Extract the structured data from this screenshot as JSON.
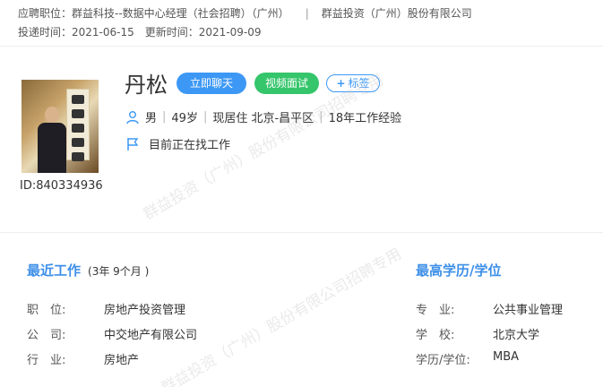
{
  "header": {
    "position_label": "应聘职位：",
    "position_value": "群益科技--数据中心经理（社会招聘）（广州）",
    "separator": "|",
    "company": "群益投资（广州）股份有限公司",
    "delivery_label": "投递时间：",
    "delivery_value": "2021-06-15",
    "update_label": "更新时间：",
    "update_value": "2021-09-09"
  },
  "profile": {
    "id_text": "ID:840334936",
    "name": "丹松",
    "buttons": {
      "chat": "立即聊天",
      "video": "视频面试",
      "tag": "标签"
    },
    "gender": "男",
    "age": "49岁",
    "residence": "现居住 北京-昌平区",
    "experience": "18年工作经验",
    "status": "目前正在找工作"
  },
  "recent_work": {
    "title": "最近工作",
    "duration": "(3年 9个月 )",
    "rows": [
      {
        "label": "职　位:",
        "value": "房地产投资管理"
      },
      {
        "label": "公　司:",
        "value": "中交地产有限公司"
      },
      {
        "label": "行　业:",
        "value": "房地产"
      }
    ]
  },
  "education": {
    "title": "最高学历/学位",
    "rows": [
      {
        "label": "专　业:",
        "value": "公共事业管理"
      },
      {
        "label": "学　校:",
        "value": "北京大学"
      },
      {
        "label": "学历/学位:",
        "value": "MBA"
      }
    ]
  },
  "watermark": {
    "line1": "群益投资（广州）股份有限公司招聘专用",
    "line2": "用"
  },
  "colors": {
    "accent": "#3d98f5",
    "video": "#35c56b",
    "section_title": "#3d8fe8"
  }
}
